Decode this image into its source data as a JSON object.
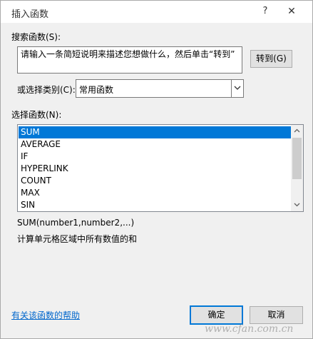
{
  "window": {
    "title": "插入函数",
    "help_label": "?",
    "close_label": "✕"
  },
  "search": {
    "label": "搜索函数(S):",
    "value": "请输入一条简短说明来描述您想做什么，然后单击“转到”",
    "goto_label": "转到(G)"
  },
  "category": {
    "label": "或选择类别(C):",
    "selected": "常用函数"
  },
  "functions": {
    "label": "选择函数(N):",
    "items": [
      "SUM",
      "AVERAGE",
      "IF",
      "HYPERLINK",
      "COUNT",
      "MAX",
      "SIN"
    ],
    "selected_index": 0
  },
  "description": {
    "signature": "SUM(number1,number2,...)",
    "text": "计算单元格区域中所有数值的和"
  },
  "footer": {
    "help_link": "有关该函数的帮助",
    "ok_label": "确定",
    "cancel_label": "取消"
  },
  "watermark": {
    "text": "www.cfan.com.cn"
  },
  "colors": {
    "accent": "#0078d7",
    "link": "#0066cc"
  }
}
